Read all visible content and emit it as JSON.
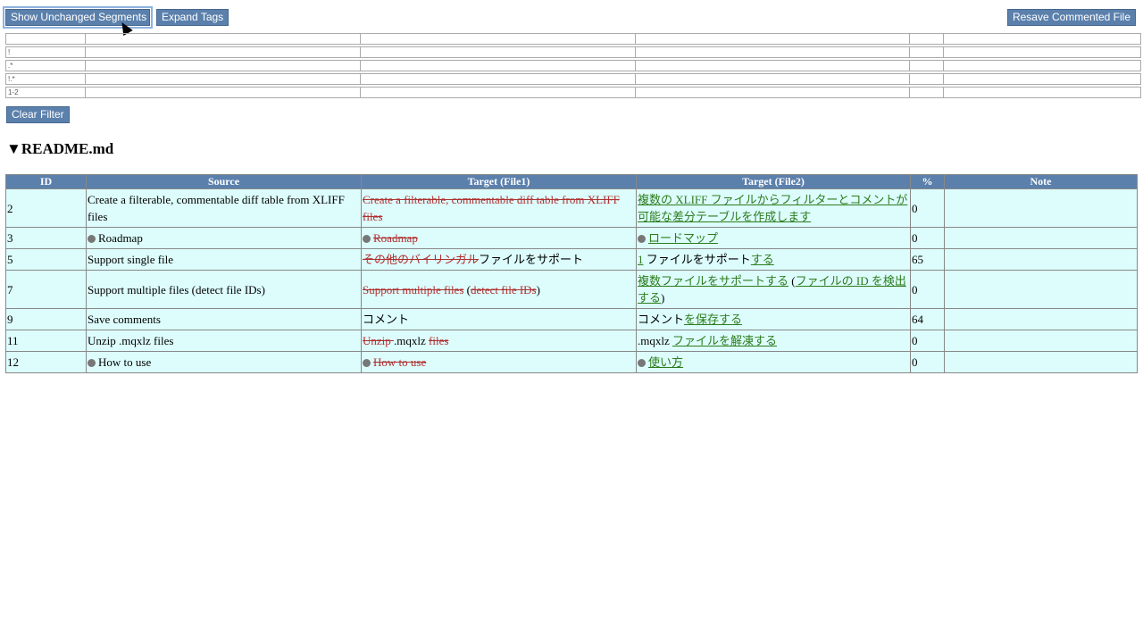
{
  "toolbar": {
    "show_unchanged": "Show Unchanged Segments",
    "expand_tags": "Expand Tags",
    "resave": "Resave Commented File",
    "clear_filter": "Clear Filter"
  },
  "filters": [
    [
      "",
      "",
      "",
      "",
      "",
      ""
    ],
    [
      "!",
      "",
      "",
      "",
      "",
      ""
    ],
    [
      ".*",
      "",
      "",
      "",
      "",
      ""
    ],
    [
      "!.*",
      "",
      "",
      "",
      "",
      ""
    ],
    [
      "1-2",
      "",
      "",
      "",
      "",
      ""
    ]
  ],
  "file_title": "▼README.md",
  "columns": [
    "ID",
    "Source",
    "Target (File1)",
    "Target (File2)",
    "%",
    "Note"
  ],
  "rows": [
    {
      "id": "2",
      "source": "Create a filterable, commentable diff table from XLIFF files",
      "t1": [
        {
          "t": "Create a filterable, commentable diff table from XLIFF files",
          "c": "del"
        }
      ],
      "t2": [
        {
          "t": "複数の XLIFF ファイルからフィルターとコメントが可能な差分テーブルを作成します",
          "c": "ins"
        }
      ],
      "pct": "0",
      "note": ""
    },
    {
      "id": "3",
      "source_icon": true,
      "source": "Roadmap",
      "t1_icon": true,
      "t1": [
        {
          "t": "Roadmap",
          "c": "del"
        }
      ],
      "t2_icon": true,
      "t2": [
        {
          "t": "ロードマップ",
          "c": "ins"
        }
      ],
      "pct": "0",
      "note": ""
    },
    {
      "id": "5",
      "source": "Support single file",
      "t1": [
        {
          "t": "その他のバイリンガル",
          "c": "del"
        },
        {
          "t": "ファイルをサポート",
          "c": ""
        }
      ],
      "t2": [
        {
          "t": "1",
          "c": "ins"
        },
        {
          "t": " ファイルをサポート",
          "c": ""
        },
        {
          "t": "する",
          "c": "ins"
        }
      ],
      "pct": "65",
      "note": ""
    },
    {
      "id": "7",
      "source": "Support multiple files (detect file IDs)",
      "t1": [
        {
          "t": "Support multiple files",
          "c": "del"
        },
        {
          "t": " (",
          "c": ""
        },
        {
          "t": "detect file IDs",
          "c": "del"
        },
        {
          "t": ")",
          "c": ""
        }
      ],
      "t2": [
        {
          "t": "複数ファイルをサポートする",
          "c": "ins"
        },
        {
          "t": " (",
          "c": ""
        },
        {
          "t": "ファイルの ID を検出する",
          "c": "ins"
        },
        {
          "t": ")",
          "c": ""
        }
      ],
      "pct": "0",
      "note": ""
    },
    {
      "id": "9",
      "source": "Save comments",
      "t1": [
        {
          "t": "コメント",
          "c": ""
        }
      ],
      "t2": [
        {
          "t": "コメント",
          "c": ""
        },
        {
          "t": "を保存する",
          "c": "ins"
        }
      ],
      "pct": "64",
      "note": ""
    },
    {
      "id": "11",
      "source": "Unzip .mqxlz files",
      "t1": [
        {
          "t": "Unzip ",
          "c": "del"
        },
        {
          "t": ".mqxlz ",
          "c": ""
        },
        {
          "t": "files",
          "c": "del"
        }
      ],
      "t2": [
        {
          "t": ".mqxlz ",
          "c": ""
        },
        {
          "t": "ファイルを解凍する",
          "c": "ins"
        }
      ],
      "pct": "0",
      "note": ""
    },
    {
      "id": "12",
      "source_icon": true,
      "source": "How to use",
      "t1_icon": true,
      "t1": [
        {
          "t": "How to use",
          "c": "del"
        }
      ],
      "t2_icon": true,
      "t2": [
        {
          "t": "使い方",
          "c": "ins"
        }
      ],
      "pct": "0",
      "note": ""
    }
  ]
}
